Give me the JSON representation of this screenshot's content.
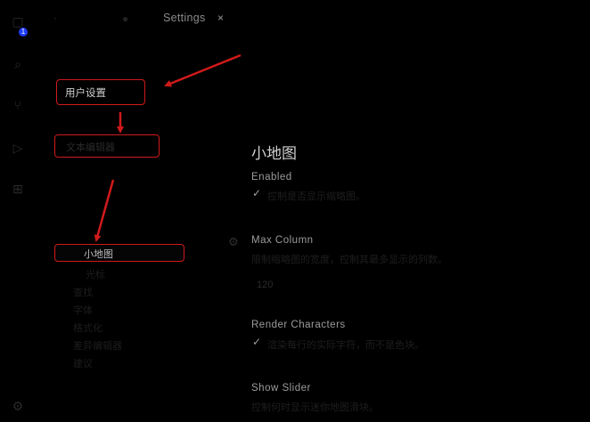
{
  "activity_bar": {
    "badge": "1",
    "items": [
      "files-icon",
      "search-icon",
      "source-control-icon",
      "run-debug-icon",
      "extensions-icon",
      "settings-gear-icon"
    ]
  },
  "tabs": {
    "active_label": "Settings",
    "close_glyph": "×"
  },
  "tree": {
    "user_settings": "用户设置",
    "editor": "文本编辑器",
    "minimap": "小地图",
    "items_dim": [
      "光标",
      "查找",
      "字体",
      "格式化",
      "差异编辑器",
      "建议"
    ]
  },
  "content": {
    "section_title": "小地图",
    "settings": [
      {
        "title": "Enabled",
        "desc": "控制是否显示缩略图。",
        "checked": true
      },
      {
        "title": "Max Column",
        "desc": "限制缩略图的宽度，控制其最多显示的列数。",
        "value": "120"
      },
      {
        "title": "Render Characters",
        "desc": "渲染每行的实际字符，而不是色块。",
        "checked": true
      },
      {
        "title": "Show Slider",
        "desc": "控制何时显示迷你地图滑块。"
      }
    ]
  },
  "colors": {
    "annotation_red": "#d01a1a",
    "badge_blue": "#1f3cff"
  }
}
